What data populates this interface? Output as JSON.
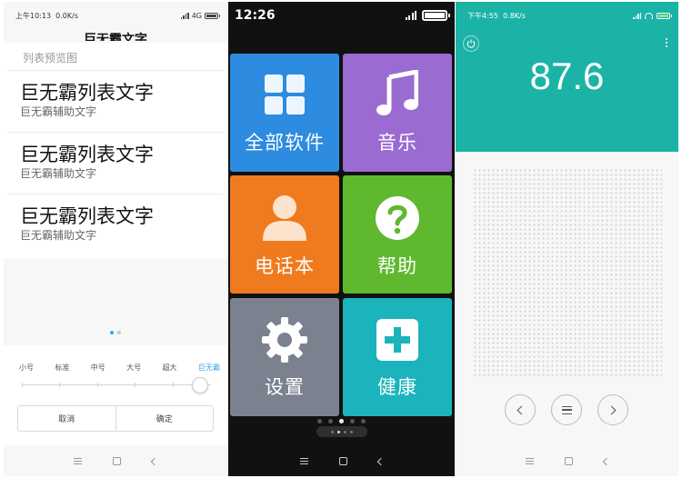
{
  "left_screen": {
    "status": {
      "time": "上午10:13",
      "speed": "0.0K/s",
      "network": "4G"
    },
    "title": "巨无霸文字",
    "preview_label": "列表预览图",
    "items": [
      {
        "main": "巨无霸列表文字",
        "sub": "巨无霸辅助文字"
      },
      {
        "main": "巨无霸列表文字",
        "sub": "巨无霸辅助文字"
      },
      {
        "main": "巨无霸列表文字",
        "sub": "巨无霸辅助文字"
      }
    ],
    "font_sizes": [
      "小号",
      "标准",
      "中号",
      "大号",
      "超大",
      "巨无霸"
    ],
    "selected_size": "巨无霸",
    "cancel_label": "取消",
    "confirm_label": "确定"
  },
  "middle_screen": {
    "status": {
      "time": "12:26"
    },
    "tiles": [
      {
        "label": "全部软件",
        "icon": "grid-icon",
        "color": "#2d8be0"
      },
      {
        "label": "音乐",
        "icon": "music-note-icon",
        "color": "#9a6bd0"
      },
      {
        "label": "电话本",
        "icon": "contact-icon",
        "color": "#f07a1e"
      },
      {
        "label": "帮助",
        "icon": "question-icon",
        "color": "#5fb82e"
      },
      {
        "label": "设置",
        "icon": "gear-icon",
        "color": "#7b818f"
      },
      {
        "label": "健康",
        "icon": "plus-icon",
        "color": "#1bb4bd"
      }
    ]
  },
  "right_screen": {
    "status": {
      "time": "下午4:55",
      "speed": "0.8K/s"
    },
    "frequency": "87.6",
    "accent": "#1bb3a5"
  }
}
